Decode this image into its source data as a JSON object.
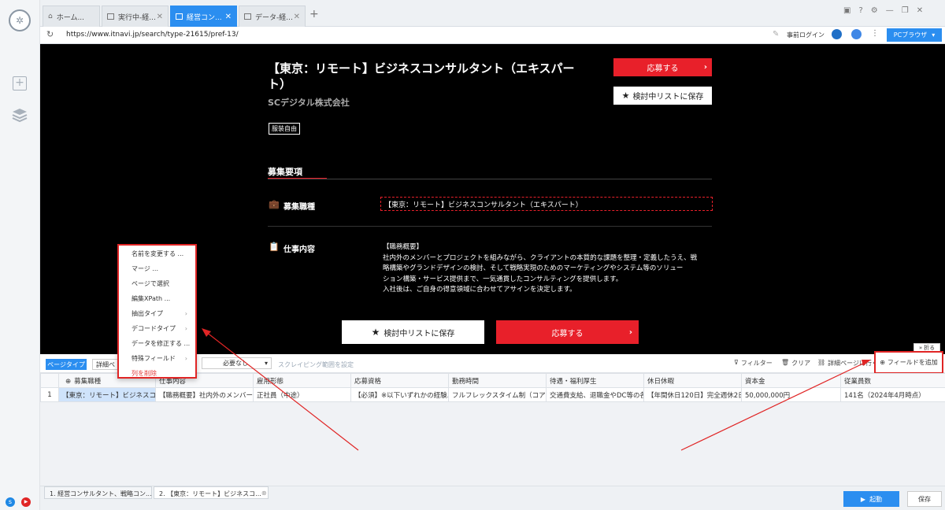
{
  "tabs": [
    {
      "label": "ホーム..."
    },
    {
      "label": "実行中-経..."
    },
    {
      "label": "経営コン..."
    },
    {
      "label": "データ-経..."
    }
  ],
  "address": {
    "url": "https://www.itnavi.jp/search/type-21615/pref-13/",
    "login_label": "事前ログイン",
    "pc_browser_label": "PCブラウザ"
  },
  "job": {
    "title_line1": "【東京：リモート】ビジネスコンサルタント（エキスパー",
    "title_line2": "ト）",
    "company": "SCデジタル株式会社",
    "tag": "服装自由",
    "apply_label": "応募する",
    "save_label": "検討中リストに保存",
    "section_title": "募集要項",
    "field1_label": "募集職種",
    "field1_value": "【東京：リモート】ビジネスコンサルタント（エキスパート）",
    "field2_label": "仕事内容",
    "desc_heading": "【職務概要】",
    "desc_line1": "社内外のメンバーとプロジェクトを組みながら、クライアントの本質的な課題を整理・定義したうえ、戦",
    "desc_line2": "略構築やグランドデザインの検討、そして戦略実現のためのマーケティングやシステム等のソリュー",
    "desc_line3": "ション構築・サービス提供まで、一気通貫したコンサルティングを提供します。",
    "desc_line4": "入社後は、ご自身の得意領域に合わせてアサインを決定します。",
    "bottom_save_label": "検討中リストに保存",
    "bottom_apply_label": "応募する"
  },
  "collapse_label": "折る",
  "toolbar": {
    "page_type": "ページタイプ",
    "detail_page": "詳細ペ",
    "necessary": "必要なし",
    "scraping_range": "スクレイピング範囲を設定",
    "filter": "フィルター",
    "clear": "クリア",
    "go_detail": "詳細ページに行く",
    "add_field": "フィールドを追加"
  },
  "context_menu": {
    "items": [
      "名前を変更する ...",
      "マージ ...",
      "ページで選択",
      "編集XPath ...",
      "抽出タイプ",
      "デコードタイプ",
      "データを修正する ...",
      "特殊フィールド",
      "列を削除"
    ]
  },
  "table": {
    "headers": [
      "募集職種",
      "仕事内容",
      "雇用形態",
      "応募資格",
      "勤務時間",
      "待遇・福利厚生",
      "休日休暇",
      "資本金",
      "従業員数"
    ],
    "row_index": "1",
    "row": [
      "【東京：リモート】ビジネスコ...",
      "【職務概要】社内外のメンバー...",
      "正社員（中途）",
      "【必須】※以下いずれかの経験...",
      "フルフレックスタイム制（コア...",
      "交通費支給、退職金やDC等の各...",
      "【年間休日120日】完全週休2日...",
      "50,000,000円",
      "141名（2024年4月時点）"
    ]
  },
  "bottom_tabs": [
    {
      "label": "1. 経営コンサルタント、戦略コン..."
    },
    {
      "label": "2. 【東京：リモート】ビジネスコ..."
    }
  ],
  "actions": {
    "start": "起動",
    "save": "保存"
  },
  "colors": {
    "accent": "#2b8ef0",
    "apply_red": "#e8202a",
    "annotation_red": "#e02525"
  }
}
